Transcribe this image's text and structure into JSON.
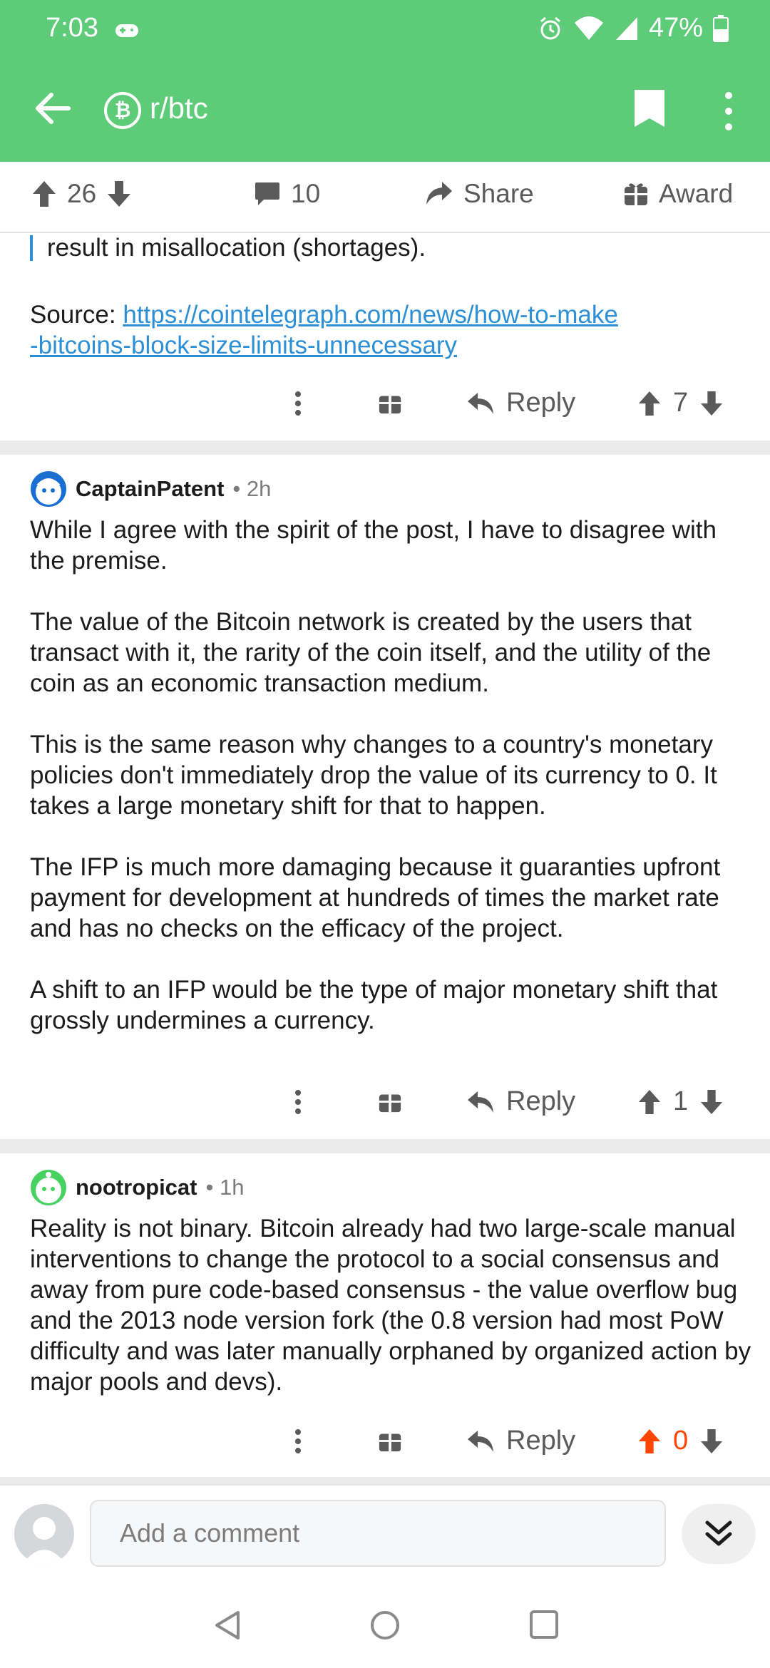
{
  "status": {
    "time": "7:03",
    "battery": "47%"
  },
  "header": {
    "subreddit": "r/btc",
    "sub_icon_glyph": "₿"
  },
  "post_actions": {
    "upvotes": "26",
    "comments": "10",
    "share_label": "Share",
    "award_label": "Award"
  },
  "prev_comment": {
    "quote_tail": "result in misallocation (shortages).",
    "source_label": "Source: ",
    "source_link_line1": "https://cointelegraph.com/news/how-to-make",
    "source_link_line2": "-bitcoins-block-size-limits-unnecessary",
    "reply_label": "Reply",
    "votes": "7"
  },
  "comments": [
    {
      "author": "CaptainPatent",
      "age": "• 2h",
      "paragraphs": [
        "While I agree with the spirit of the post, I have to disagree with the premise.",
        "The value of the Bitcoin network is created by the users that transact with it, the rarity of the coin itself, and the utility of the coin as an economic transaction medium.",
        "This is the same reason why changes to a country's monetary policies don't immediately drop the value of its currency to 0. It takes a large monetary shift for that to happen.",
        "The IFP is much more damaging because it guaranties upfront payment for development at hundreds of times the market rate and has no checks on the efficacy of the project.",
        "A shift to an IFP would be the type of major monetary shift that grossly undermines a currency."
      ],
      "reply_label": "Reply",
      "votes": "1"
    },
    {
      "author": "nootropicat",
      "age": "• 1h",
      "paragraphs": [
        "Reality is not binary. Bitcoin already had two large-scale manual interventions to change the protocol to a social consensus and away from pure code-based consensus - the value overflow bug and the 2013 node version fork (the 0.8 version had most PoW difficulty and was later manually orphaned by organized action by major pools and devs)."
      ],
      "reply_label": "Reply",
      "votes": "0"
    }
  ],
  "composer": {
    "placeholder": "Add a comment"
  },
  "colors": {
    "header": "#5ecb78",
    "link": "#2d8fd5",
    "upvoted": "#ff4500",
    "icon_gray": "#5a5a5a"
  },
  "icons": [
    "back-arrow-icon",
    "bitcoin-icon",
    "bookmark-icon",
    "more-vertical-icon",
    "upvote-icon",
    "downvote-icon",
    "comment-icon",
    "share-icon",
    "gift-icon",
    "reply-icon",
    "double-chevron-down-icon",
    "nav-back-icon",
    "nav-home-icon",
    "nav-recents-icon"
  ]
}
